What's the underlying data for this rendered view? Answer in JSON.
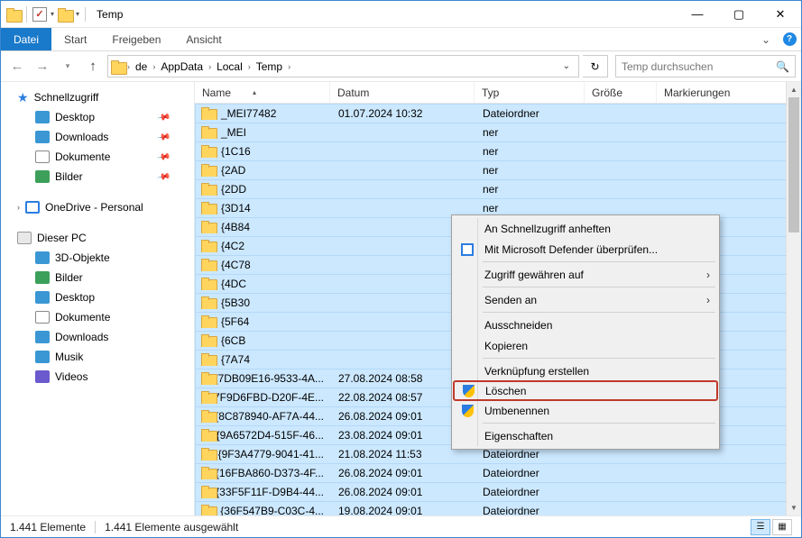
{
  "window": {
    "title": "Temp"
  },
  "ribbon": {
    "file": "Datei",
    "tabs": [
      "Start",
      "Freigeben",
      "Ansicht"
    ]
  },
  "breadcrumbs": [
    "de",
    "AppData",
    "Local",
    "Temp"
  ],
  "search": {
    "placeholder": "Temp durchsuchen"
  },
  "columns": {
    "name": "Name",
    "date": "Datum",
    "type": "Typ",
    "size": "Größe",
    "mark": "Markierungen"
  },
  "sidebar": {
    "quick": "Schnellzugriff",
    "quick_items": [
      "Desktop",
      "Downloads",
      "Dokumente",
      "Bilder"
    ],
    "onedrive": "OneDrive - Personal",
    "pc": "Dieser PC",
    "pc_items": [
      "3D-Objekte",
      "Bilder",
      "Desktop",
      "Dokumente",
      "Downloads",
      "Musik",
      "Videos"
    ]
  },
  "rows": [
    {
      "name": "_MEI77482",
      "date": "01.07.2024 10:32",
      "type": "Dateiordner"
    },
    {
      "name": "_MEI",
      "date": "",
      "type": "ner"
    },
    {
      "name": "{1C16",
      "date": "",
      "type": "ner"
    },
    {
      "name": "{2AD",
      "date": "",
      "type": "ner"
    },
    {
      "name": "{2DD",
      "date": "",
      "type": "ner"
    },
    {
      "name": "{3D14",
      "date": "",
      "type": "ner"
    },
    {
      "name": "{4B84",
      "date": "",
      "type": "ner"
    },
    {
      "name": "{4C2",
      "date": "",
      "type": "ner"
    },
    {
      "name": "{4C78",
      "date": "",
      "type": "ner"
    },
    {
      "name": "{4DC",
      "date": "",
      "type": "ner"
    },
    {
      "name": "{5B30",
      "date": "",
      "type": "ner"
    },
    {
      "name": "{5F64",
      "date": "",
      "type": "ner"
    },
    {
      "name": "{6CB",
      "date": "",
      "type": "ner"
    },
    {
      "name": "{7A74",
      "date": "",
      "type": "ner"
    },
    {
      "name": "{7DB09E16-9533-4A...",
      "date": "27.08.2024 08:58",
      "type": "Dateiordner"
    },
    {
      "name": "{7F9D6FBD-D20F-4E...",
      "date": "22.08.2024 08:57",
      "type": "Dateiordner"
    },
    {
      "name": "{8C878940-AF7A-44...",
      "date": "26.08.2024 09:01",
      "type": "Dateiordner"
    },
    {
      "name": "{9A6572D4-515F-46...",
      "date": "23.08.2024 09:01",
      "type": "Dateiordner"
    },
    {
      "name": "{9F3A4779-9041-41...",
      "date": "21.08.2024 11:53",
      "type": "Dateiordner"
    },
    {
      "name": "{16FBA860-D373-4F...",
      "date": "26.08.2024 09:01",
      "type": "Dateiordner"
    },
    {
      "name": "{33F5F11F-D9B4-44...",
      "date": "26.08.2024 09:01",
      "type": "Dateiordner"
    },
    {
      "name": "{36F547B9-C03C-4...",
      "date": "19.08.2024 09:01",
      "type": "Dateiordner"
    }
  ],
  "context_menu": {
    "pin": "An Schnellzugriff anheften",
    "defender": "Mit Microsoft Defender überprüfen...",
    "access": "Zugriff gewähren auf",
    "sendto": "Senden an",
    "cut": "Ausschneiden",
    "copy": "Kopieren",
    "shortcut": "Verknüpfung erstellen",
    "delete": "Löschen",
    "rename": "Umbenennen",
    "properties": "Eigenschaften"
  },
  "status": {
    "count": "1.441 Elemente",
    "selected": "1.441 Elemente ausgewählt"
  }
}
